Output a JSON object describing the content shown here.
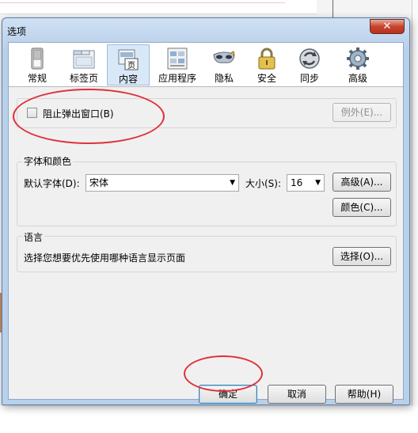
{
  "window": {
    "title": "选项",
    "close_glyph": "✕"
  },
  "tabs": [
    {
      "label": "常规",
      "icon": "switch-icon"
    },
    {
      "label": "标签页",
      "icon": "window-tabs-icon"
    },
    {
      "label": "内容",
      "icon": "page-content-icon",
      "selected": true,
      "icon_glyph": "页"
    },
    {
      "label": "应用程序",
      "icon": "applications-icon"
    },
    {
      "label": "隐私",
      "icon": "mask-icon"
    },
    {
      "label": "安全",
      "icon": "padlock-icon"
    },
    {
      "label": "同步",
      "icon": "sync-icon"
    },
    {
      "label": "高级",
      "icon": "gear-icon"
    }
  ],
  "popup": {
    "checkbox_label": "阻止弹出窗口(B)",
    "checked": false,
    "exceptions_button": "例外(E)..."
  },
  "fonts": {
    "group_label": "字体和颜色",
    "default_font_label": "默认字体(D):",
    "default_font_value": "宋体",
    "size_label": "大小(S):",
    "size_value": "16",
    "advanced_button": "高级(A)...",
    "colors_button": "颜色(C)..."
  },
  "language": {
    "group_label": "语言",
    "description": "选择您想要优先使用哪种语言显示页面",
    "choose_button": "选择(O)..."
  },
  "footer": {
    "ok": "确定",
    "cancel": "取消",
    "help": "帮助(H)"
  },
  "colors": {
    "annotation": "#e0303a",
    "title_bar": "#b9d0ea",
    "selected_tab": "#d9e8f7"
  }
}
